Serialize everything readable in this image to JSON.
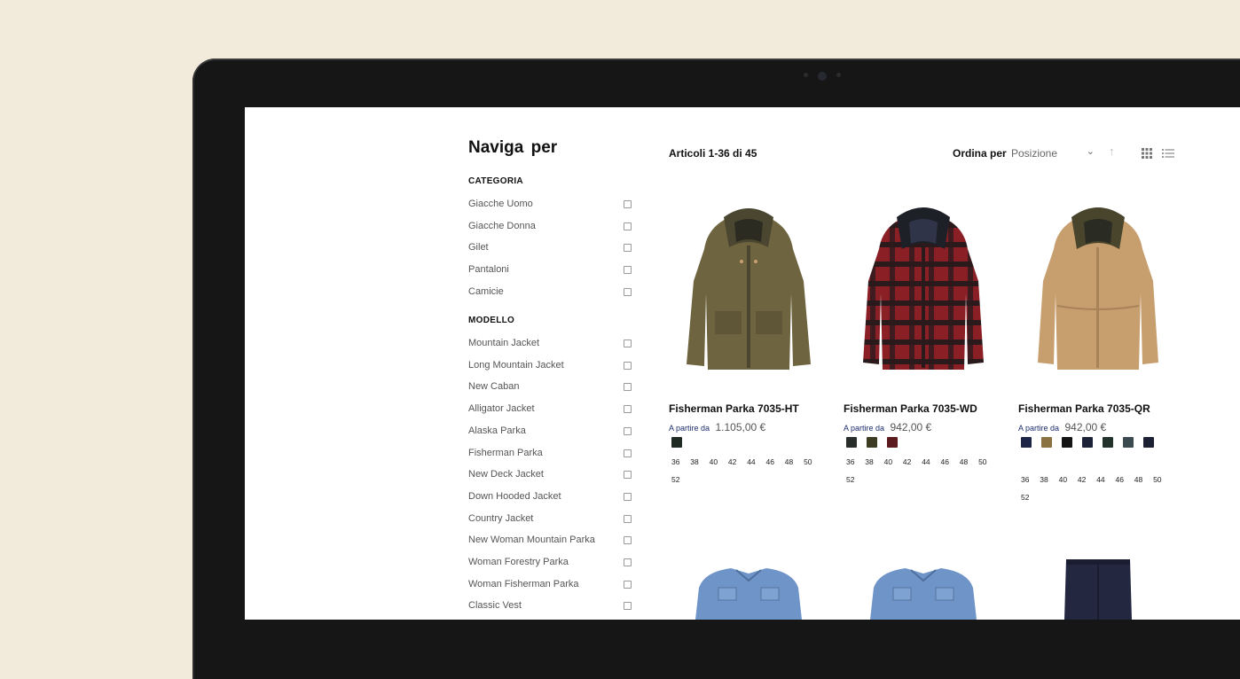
{
  "sidebar": {
    "title": "Naviga per",
    "categoria": {
      "heading": "CATEGORIA",
      "items": [
        "Giacche Uomo",
        "Giacche Donna",
        "Gilet",
        "Pantaloni",
        "Camicie"
      ]
    },
    "modello": {
      "heading": "MODELLO",
      "items": [
        "Mountain Jacket",
        "Long Mountain Jacket",
        "New Caban",
        "Alligator Jacket",
        "Alaska Parka",
        "Fisherman Parka",
        "New Deck Jacket",
        "Down Hooded Jacket",
        "Country Jacket",
        "New Woman Mountain Parka",
        "Woman Forestry Parka",
        "Woman Fisherman Parka",
        "Classic Vest"
      ]
    }
  },
  "toolbar": {
    "count": "Articoli 1-36 di 45",
    "sort_label": "Ordina per",
    "sort_value": "Posizione"
  },
  "products": [
    {
      "name": "Fisherman Parka 7035-HT",
      "price_prefix": "A partire da",
      "price": "1.105,00 €",
      "swatches": [
        "#1f2a22"
      ],
      "sizes": [
        "36",
        "38",
        "40",
        "42",
        "44",
        "46",
        "48",
        "50",
        "52"
      ]
    },
    {
      "name": "Fisherman Parka 7035-WD",
      "price_prefix": "A partire da",
      "price": "942,00 €",
      "swatches": [
        "#2a2e2a",
        "#3d3b22",
        "#5a1a1e"
      ],
      "sizes": [
        "36",
        "38",
        "40",
        "42",
        "44",
        "46",
        "48",
        "50",
        "52"
      ]
    },
    {
      "name": "Fisherman Parka 7035-QR",
      "price_prefix": "A partire da",
      "price": "942,00 €",
      "swatches": [
        "#1d2446",
        "#8a7340",
        "#141414",
        "#1c2238",
        "#23332b",
        "#3a4a4e",
        "#1b2032"
      ],
      "sizes": [
        "36",
        "38",
        "40",
        "42",
        "44",
        "46",
        "48",
        "50",
        "52"
      ]
    }
  ],
  "icons": {
    "checkbox": "checkbox-icon",
    "sort_chevron": "chevron-down-icon",
    "sort_direction": "arrow-up-icon",
    "grid_view": "grid-view-icon",
    "list_view": "list-view-icon"
  },
  "colors": {
    "background": "#f2eada",
    "bezel": "#161616",
    "price_prefix": "#1d2d6e"
  }
}
